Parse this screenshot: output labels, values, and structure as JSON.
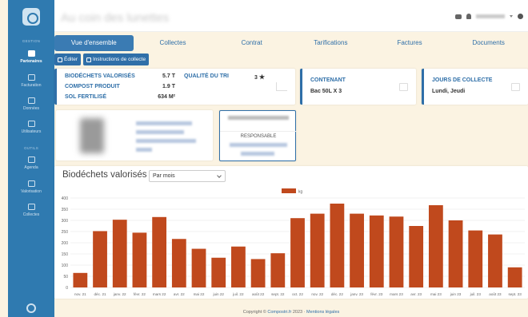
{
  "sidebar": {
    "sections": [
      "GESTION",
      "OUTILS"
    ],
    "items": [
      {
        "label": "Partenaires",
        "icon": "handshake-icon",
        "active": true
      },
      {
        "label": "Facturation",
        "icon": "invoice-icon"
      },
      {
        "label": "Données",
        "icon": "table-icon"
      },
      {
        "label": "Utilisateurs",
        "icon": "users-icon"
      },
      {
        "label": "Agenda",
        "icon": "calendar-icon"
      },
      {
        "label": "Valorisation",
        "icon": "truck-icon"
      },
      {
        "label": "Collectes",
        "icon": "bike-icon"
      }
    ],
    "help_icon": "lifebuoy-icon"
  },
  "header": {
    "title": "Au coin des lunettes"
  },
  "tabs": [
    "Vue d'ensemble",
    "Collectes",
    "Contrat",
    "Tarifications",
    "Factures",
    "Documents"
  ],
  "actions": {
    "edit_label": "Éditer",
    "instructions_label": "Instructions de collecte"
  },
  "stats": {
    "biodechets_label": "BIODÉCHETS VALORISÉS",
    "biodechets_value": "5.7 T",
    "compost_label": "COMPOST PRODUIT",
    "compost_value": "1.9 T",
    "sol_label": "SOL FERTILISÉ",
    "sol_value": "634 M²",
    "quality_label": "QUALITÉ DU TRI",
    "quality_value": "3"
  },
  "container": {
    "label": "CONTENANT",
    "value": "Bac 50L X 3"
  },
  "collection_days": {
    "label": "JOURS DE COLLECTE",
    "value": "Lundi, Jeudi"
  },
  "responsible": {
    "role": "RESPONSABLE"
  },
  "chart_section": {
    "title": "Biodéchets valorisés",
    "period": "Par mois"
  },
  "chart_data": {
    "type": "bar",
    "categories": [
      "nov. 21",
      "déc. 21",
      "janv. 22",
      "févr. 22",
      "mars 22",
      "avr. 22",
      "mai 22",
      "juin 22",
      "juil. 22",
      "août 22",
      "sept. 22",
      "oct. 22",
      "nov. 22",
      "déc. 22",
      "janv. 23",
      "févr. 23",
      "mars 23",
      "avr. 23",
      "mai 23",
      "juin 23",
      "juil. 23",
      "août 23",
      "sept. 23"
    ],
    "series": [
      {
        "name": "kg",
        "values": [
          65,
          252,
          303,
          245,
          315,
          217,
          173,
          133,
          183,
          127,
          153,
          310,
          330,
          375,
          330,
          322,
          317,
          275,
          368,
          300,
          255,
          237,
          90
        ]
      }
    ],
    "ylim": [
      0,
      400
    ],
    "yticks": [
      0,
      50,
      100,
      150,
      200,
      250,
      300,
      350,
      400
    ],
    "grid": true,
    "legend": "top",
    "color": "#c0491d"
  },
  "footer": {
    "prefix": "Copyright © ",
    "link": "Compostri.fr",
    "suffix": " 2023 · ",
    "legal": "Mentions légales"
  }
}
